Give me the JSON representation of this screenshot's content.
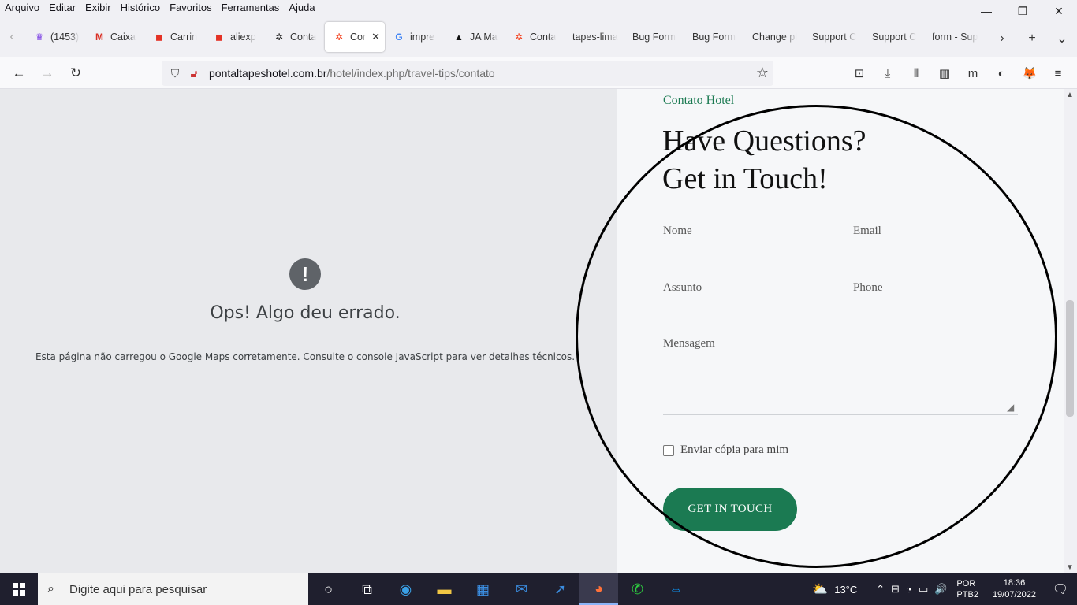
{
  "menubar": {
    "items": [
      "Arquivo",
      "Editar",
      "Exibir",
      "Histórico",
      "Favoritos",
      "Ferramentas",
      "Ajuda"
    ]
  },
  "window_controls": {
    "minimize": "—",
    "restore": "❐",
    "close": "✕"
  },
  "tabs": [
    {
      "title": "(1453)",
      "icon": "crown-icon",
      "glyph": "♛",
      "color": "#7b3fe4"
    },
    {
      "title": "Caixa",
      "icon": "gmail-icon",
      "glyph": "M",
      "color": "#d93025"
    },
    {
      "title": "Carrin",
      "icon": "shop-bag-icon",
      "glyph": "◼",
      "color": "#e43225"
    },
    {
      "title": "aliexp",
      "icon": "shop-bag-icon",
      "glyph": "◼",
      "color": "#e43225"
    },
    {
      "title": "Conta",
      "icon": "joomla-icon",
      "glyph": "✲",
      "color": "#222222"
    },
    {
      "title": "Cor",
      "icon": "joomla-icon",
      "glyph": "✲",
      "color": "#f44321",
      "active": true,
      "close": "✕"
    },
    {
      "title": "impre",
      "icon": "google-icon",
      "glyph": "G",
      "color": "#4285f4"
    },
    {
      "title": "JA Ma",
      "icon": "ja-logo-icon",
      "glyph": "▲",
      "color": "#111111"
    },
    {
      "title": "Conta",
      "icon": "joomla-icon",
      "glyph": "✲",
      "color": "#f44321"
    },
    {
      "title": "tapes-lima",
      "icon": "",
      "glyph": "",
      "color": "#333333"
    },
    {
      "title": "Bug Form",
      "icon": "",
      "glyph": "",
      "color": "#333333"
    },
    {
      "title": "Bug Form",
      "icon": "",
      "glyph": "",
      "color": "#333333"
    },
    {
      "title": "Change pl",
      "icon": "",
      "glyph": "",
      "color": "#333333"
    },
    {
      "title": "Support C",
      "icon": "",
      "glyph": "",
      "color": "#333333"
    },
    {
      "title": "Support C",
      "icon": "",
      "glyph": "",
      "color": "#333333"
    },
    {
      "title": "form - Sup",
      "icon": "",
      "glyph": "",
      "color": "#333333"
    }
  ],
  "tabbar_buttons": {
    "scroll_right": "›",
    "new_tab": "+",
    "list_all": "⌄",
    "scroll_left": "‹"
  },
  "navbar": {
    "back": "←",
    "forward": "→",
    "reload": "↻",
    "url_host": "pontaltapeshotel.com.br",
    "url_path": "/hotel/index.php/travel-tips/contato",
    "bookmark_star": "☆",
    "right_icons": [
      "⊡",
      "⤓",
      "⫴",
      "▥",
      "m",
      "◐",
      "🦊",
      "≡"
    ]
  },
  "map_error": {
    "icon": "!",
    "title": "Ops! Algo deu errado.",
    "message": "Esta página não carregou o Google Maps corretamente. Consulte o console JavaScript para ver detalhes técnicos."
  },
  "contact": {
    "eyebrow": "Contato Hotel",
    "headline_line1": "Have Questions?",
    "headline_line2": "Get in Touch!",
    "fields": {
      "nome": "Nome",
      "email": "Email",
      "assunto": "Assunto",
      "phone": "Phone",
      "mensagem": "Mensagem"
    },
    "copy_label": "Enviar cópia para mim",
    "submit_label": "GET IN TOUCH"
  },
  "scrollbar": {
    "up": "▲",
    "down": "▼",
    "position": 0.58
  },
  "taskbar": {
    "search_placeholder": "Digite aqui para pesquisar",
    "search_icon": "⌕",
    "apps": [
      {
        "name": "cortana-icon",
        "glyph": "○",
        "color": "#ffffff"
      },
      {
        "name": "task-view-icon",
        "glyph": "⧉",
        "color": "#ffffff"
      },
      {
        "name": "edge-icon",
        "glyph": "◉",
        "color": "#3aa0e6"
      },
      {
        "name": "file-explorer-icon",
        "glyph": "▬",
        "color": "#f2c744"
      },
      {
        "name": "store-icon",
        "glyph": "▦",
        "color": "#3b8de0"
      },
      {
        "name": "mail-icon",
        "glyph": "✉",
        "color": "#3b8de0"
      },
      {
        "name": "arrow-app-icon",
        "glyph": "➚",
        "color": "#3b8de0"
      },
      {
        "name": "firefox-icon",
        "glyph": "◕",
        "color": "#ff7139",
        "active": true
      },
      {
        "name": "phone-app-icon",
        "glyph": "✆",
        "color": "#2ecc40"
      },
      {
        "name": "teamviewer-icon",
        "glyph": "⇔",
        "color": "#0e8ee9"
      }
    ],
    "weather": "13°C",
    "weather_icon": "⛅",
    "tray_icons": [
      "⌃",
      "⊟",
      "◔",
      "▭",
      "🔊"
    ],
    "lang_line1": "POR",
    "lang_line2": "PTB2",
    "time": "18:36",
    "date": "19/07/2022",
    "notification_icon": "🗨"
  }
}
